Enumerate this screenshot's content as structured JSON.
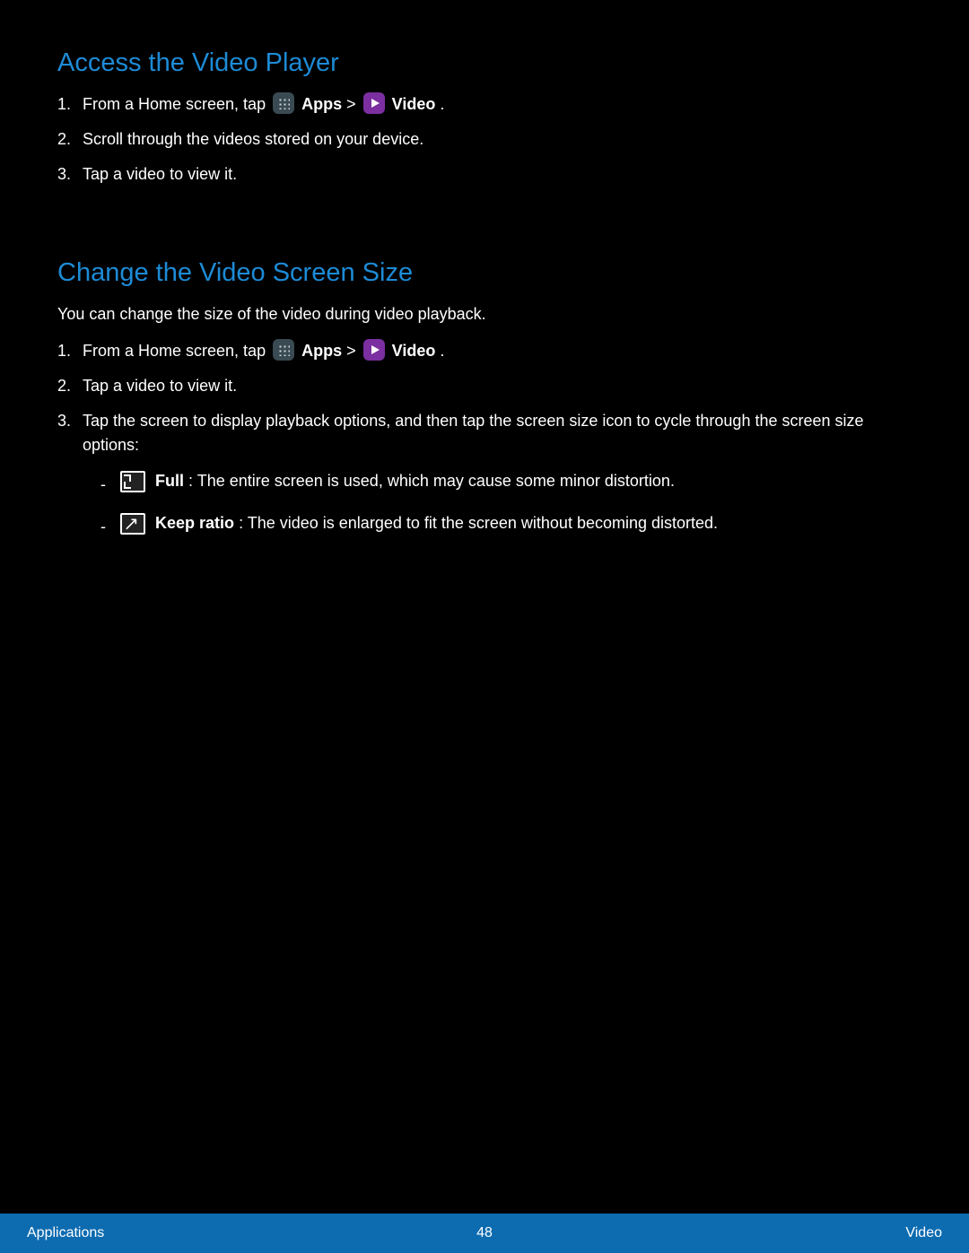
{
  "section1": {
    "heading": "Access the Video Player",
    "step1_pre": "From a Home screen, tap ",
    "step1_apps": " Apps",
    "step1_mid": " > ",
    "step1_video": " Video",
    "step1_post": ".",
    "step2": "Scroll through the videos stored on your device.",
    "step3": "Tap a video to view it.",
    "num1": "1.",
    "num2": "2.",
    "num3": "3."
  },
  "section2": {
    "heading": "Change the Video Screen Size",
    "para": "You can change the size of the video during video playback.",
    "step1_pre": "From a Home screen, tap ",
    "step1_apps": " Apps",
    "step1_mid": " > ",
    "step1_video": " Video",
    "step1_post": ".",
    "step2": "Tap a video to view it.",
    "step3": "Tap the screen to display playback options, and then tap the screen size icon to cycle through the screen size options:",
    "dash1_label": " Full",
    "dash1_text": ": The entire screen is used, which may cause some minor distortion.",
    "dash2_label": " Keep ratio",
    "dash2_text": ": The video is enlarged to fit the screen without becoming distorted.",
    "num1": "1.",
    "num2": "2.",
    "num3": "3.",
    "dash": "-"
  },
  "footer": {
    "left": "Applications",
    "center": "48",
    "right": "Video"
  }
}
